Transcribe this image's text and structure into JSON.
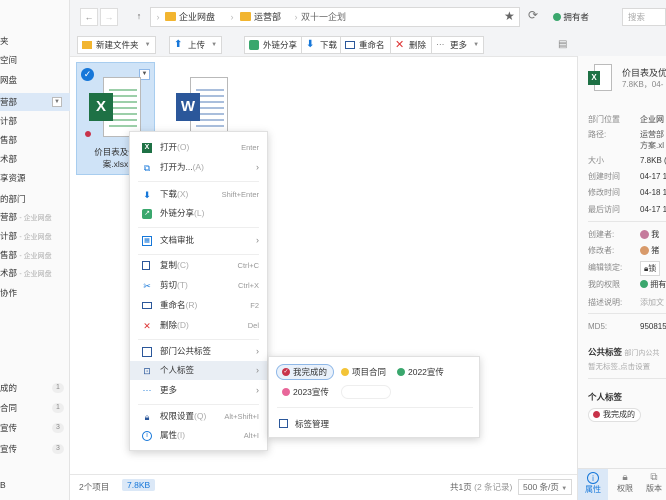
{
  "colors": {
    "accent": "#1677d9",
    "folder": "#f2b530",
    "excel": "#1e7145",
    "word": "#2b579a",
    "tag_done": "#c8334a",
    "tag_contract": "#f3c438",
    "tag_2022": "#3aa76d",
    "tag_2023": "#e8679a",
    "owner_badge": "#3aa76d"
  },
  "sidebar": {
    "items": [
      {
        "label": "夹"
      },
      {
        "label": "空间"
      },
      {
        "label": "网盘"
      },
      {
        "label": "营部"
      },
      {
        "label": "计部"
      },
      {
        "label": "售部"
      },
      {
        "label": "术部"
      },
      {
        "label": "享资源"
      },
      {
        "label": "的部门"
      },
      {
        "label": "营部",
        "suffix": "- 企业网盘"
      },
      {
        "label": "计部",
        "suffix": "- 企业网盘"
      },
      {
        "label": "售部",
        "suffix": "- 企业网盘"
      },
      {
        "label": "术部",
        "suffix": "- 企业网盘"
      },
      {
        "label": "协作"
      },
      {
        "label": "成的",
        "badge": "1"
      },
      {
        "label": "合同",
        "badge": "1"
      },
      {
        "label": "宣传",
        "badge": "3"
      },
      {
        "label": "宣传",
        "badge": "3"
      },
      {
        "label": "B"
      }
    ]
  },
  "topbar": {
    "back_icon": "arrow-left-icon",
    "forward_icon": "arrow-right-icon",
    "up_icon": "arrow-up-icon",
    "breadcrumbs": [
      "企业网盘",
      "运营部",
      "双十一企划"
    ],
    "star_icon": "star-icon",
    "refresh_icon": "refresh-icon",
    "owner_label": "拥有者",
    "search_placeholder": "搜索"
  },
  "toolbar": {
    "new_folder": "新建文件夹",
    "upload": "上传",
    "share_link": "外链分享",
    "download": "下载",
    "rename": "重命名",
    "delete": "删除",
    "more": "更多"
  },
  "files": [
    {
      "name_line1": "价目表及优",
      "name_line2": "案.xlsx",
      "type": "excel",
      "selected": true
    },
    {
      "name_line1": "",
      "name_line2": "",
      "type": "word",
      "selected": false
    }
  ],
  "context_menu": {
    "items": [
      {
        "label": "打开",
        "key": "(O)",
        "shortcut": "Enter",
        "icon": "open-icon"
      },
      {
        "label": "打开为...",
        "key": "(A)",
        "submenu": true,
        "icon": "open-as-icon"
      },
      {
        "label": "下载",
        "key": "(X)",
        "shortcut": "Shift+Enter",
        "icon": "download-icon"
      },
      {
        "label": "外链分享",
        "key": "(L)",
        "icon": "share-link-icon"
      },
      {
        "label": "文档审批",
        "submenu": true,
        "icon": "approval-icon"
      },
      {
        "label": "复制",
        "key": "(C)",
        "shortcut": "Ctrl+C",
        "icon": "copy-icon"
      },
      {
        "label": "剪切",
        "key": "(T)",
        "shortcut": "Ctrl+X",
        "icon": "cut-icon"
      },
      {
        "label": "重命名",
        "key": "(R)",
        "shortcut": "F2",
        "icon": "rename-icon"
      },
      {
        "label": "删除",
        "key": "(D)",
        "shortcut": "Del",
        "icon": "delete-icon"
      },
      {
        "label": "部门公共标签",
        "submenu": true,
        "icon": "public-tag-icon"
      },
      {
        "label": "个人标签",
        "submenu": true,
        "icon": "personal-tag-icon"
      },
      {
        "label": "更多",
        "submenu": true,
        "icon": "more-icon"
      },
      {
        "label": "权限设置",
        "key": "(Q)",
        "shortcut": "Alt+Shift+I",
        "icon": "lock-icon"
      },
      {
        "label": "属性",
        "key": "(I)",
        "shortcut": "Alt+I",
        "icon": "info-icon"
      }
    ]
  },
  "tag_submenu": {
    "tags": [
      "我完成的",
      "项目合同",
      "2022宣传",
      "2023宣传"
    ],
    "manage_label": "标签管理"
  },
  "status": {
    "count": "2个项目",
    "size": "7.8KB",
    "pages": "共1页",
    "records": "(2 条记录)",
    "per_page": "500 条/页"
  },
  "panel": {
    "file_name": "价目表及优",
    "file_meta": "7.8KB，04-",
    "location_label": "部门位置",
    "location_value": "企业网",
    "path_label": "路径:",
    "path_value1": "运营部",
    "path_value2": "方案.xl",
    "size_label": "大小",
    "size_value": "7.8KB (",
    "created_label": "创建时间",
    "created_value": "04-17 1",
    "modified_label": "修改时间",
    "modified_value": "04-18 1",
    "last_access_label": "最后访问",
    "last_access_value": "04-17 1",
    "creator_label": "创建者:",
    "creator_value": "我",
    "modifier_label": "修改者:",
    "modifier_value": "猪",
    "lock_label": "编辑锁定:",
    "lock_value": "锁",
    "perm_label": "我的权限",
    "perm_value": "拥有",
    "desc_label": "描述说明:",
    "desc_value": "添加文",
    "md5_label": "MD5:",
    "md5_value": "950815",
    "public_tags_title": "公共标签",
    "public_tags_hint": "部门内公共",
    "public_tags_empty": "暂无标签,点击设置",
    "personal_tags_title": "个人标签",
    "personal_tag": "我完成的",
    "tab_props": "属性",
    "tab_perm": "权限",
    "tab_version": "版本"
  }
}
